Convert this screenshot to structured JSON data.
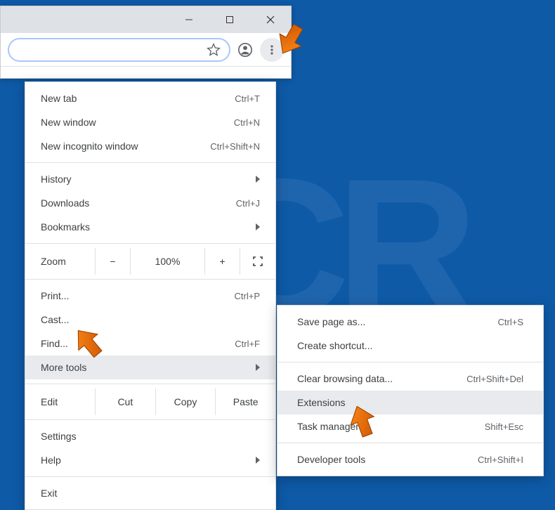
{
  "window": {
    "minimize": "–",
    "maximize": "▢",
    "close": "✕"
  },
  "omnibox": {
    "placeholder": ""
  },
  "menu": {
    "new_tab": {
      "label": "New tab",
      "shortcut": "Ctrl+T"
    },
    "new_window": {
      "label": "New window",
      "shortcut": "Ctrl+N"
    },
    "new_incognito": {
      "label": "New incognito window",
      "shortcut": "Ctrl+Shift+N"
    },
    "history": {
      "label": "History"
    },
    "downloads": {
      "label": "Downloads",
      "shortcut": "Ctrl+J"
    },
    "bookmarks": {
      "label": "Bookmarks"
    },
    "zoom": {
      "label": "Zoom",
      "minus": "−",
      "value": "100%",
      "plus": "+"
    },
    "print": {
      "label": "Print...",
      "shortcut": "Ctrl+P"
    },
    "cast": {
      "label": "Cast..."
    },
    "find": {
      "label": "Find...",
      "shortcut": "Ctrl+F"
    },
    "more_tools": {
      "label": "More tools"
    },
    "edit": {
      "label": "Edit",
      "cut": "Cut",
      "copy": "Copy",
      "paste": "Paste"
    },
    "settings": {
      "label": "Settings"
    },
    "help": {
      "label": "Help"
    },
    "exit": {
      "label": "Exit"
    }
  },
  "submenu": {
    "save_page": {
      "label": "Save page as...",
      "shortcut": "Ctrl+S"
    },
    "create_shortcut": {
      "label": "Create shortcut..."
    },
    "clear_data": {
      "label": "Clear browsing data...",
      "shortcut": "Ctrl+Shift+Del"
    },
    "extensions": {
      "label": "Extensions"
    },
    "task_manager": {
      "label": "Task manager",
      "shortcut": "Shift+Esc"
    },
    "dev_tools": {
      "label": "Developer tools",
      "shortcut": "Ctrl+Shift+I"
    }
  }
}
